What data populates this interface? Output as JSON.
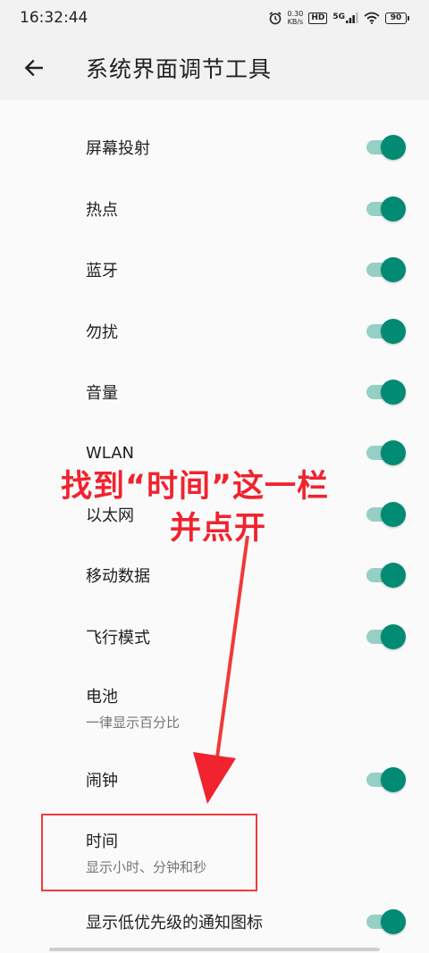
{
  "status_bar": {
    "time": "16:32:44",
    "net_speed_value": "0.30",
    "net_speed_unit": "KB/s",
    "hd_label": "HD",
    "network_label": "5G",
    "battery_level": "90"
  },
  "app_bar": {
    "title": "系统界面调节工具"
  },
  "rows": [
    {
      "title": "屏幕投射",
      "switch_on": true
    },
    {
      "title": "热点",
      "switch_on": true
    },
    {
      "title": "蓝牙",
      "switch_on": true
    },
    {
      "title": "勿扰",
      "switch_on": true
    },
    {
      "title": "音量",
      "switch_on": true
    },
    {
      "title": "WLAN",
      "switch_on": true
    },
    {
      "title": "以太网",
      "switch_on": true
    },
    {
      "title": "移动数据",
      "switch_on": true
    },
    {
      "title": "飞行模式",
      "switch_on": true
    },
    {
      "title": "电池",
      "subtitle": "一律显示百分比"
    },
    {
      "title": "闹钟",
      "switch_on": true
    },
    {
      "title": "时间",
      "subtitle": "显示小时、分钟和秒"
    },
    {
      "title": "显示低优先级的通知图标",
      "switch_on": true
    }
  ],
  "annotation": {
    "line1": "找到“时间”这一栏",
    "line2": "并点开",
    "color": "#f0232f"
  },
  "colors": {
    "switch_thumb": "#018b75",
    "switch_track": "#96cfc4",
    "background": "#fafafa",
    "bar_background": "#f2f2f2"
  }
}
